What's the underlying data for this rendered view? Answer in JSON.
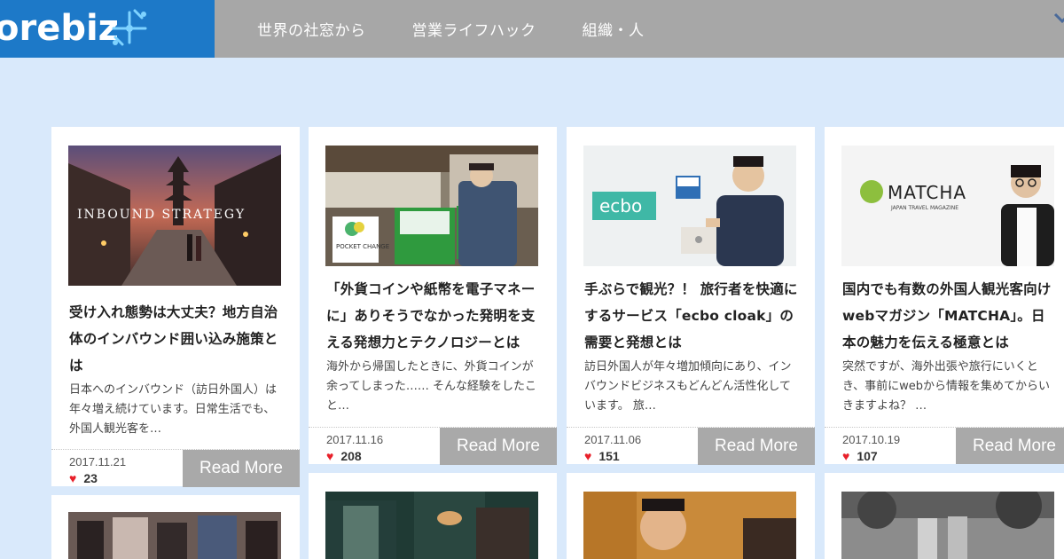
{
  "header": {
    "logo_text": "orebiz",
    "nav": [
      "世界の社窓から",
      "営業ライフハック",
      "組織・人"
    ]
  },
  "colors": {
    "brand_blue": "#1d79c8",
    "header_gray": "#a7a7a7",
    "background": "#d9e9fb",
    "heart": "#e8202a"
  },
  "cards": [
    {
      "thumb_caption": "INBOUND STRATEGY",
      "title": "受け入れ態勢は大丈夫？地方自治体のインバウンド囲い込み施策とは",
      "excerpt": "日本へのインバウンド（訪日外国人）は年々増え続けています。日常生活でも、外国人観光客を…",
      "date": "2017.11.21",
      "likes": "23",
      "read_more": "Read More"
    },
    {
      "thumb_caption": "POCKET CHANGE",
      "title": "「外貨コインや紙幣を電子マネーに」ありそうでなかった発明を支える発想力とテクノロジーとは",
      "excerpt": "海外から帰国したときに、外貨コインが余ってしまった…… そんな経験をしたこと…",
      "date": "2017.11.16",
      "likes": "208",
      "read_more": "Read More"
    },
    {
      "thumb_caption": "ecbo",
      "title": "手ぶらで観光？！ 旅行者を快適にするサービス「ecbo cloak」の需要と発想とは",
      "excerpt": "訪日外国人が年々増加傾向にあり、インバウンドビジネスもどんどん活性化しています。 旅…",
      "date": "2017.11.06",
      "likes": "151",
      "read_more": "Read More"
    },
    {
      "thumb_caption": "MATCHA",
      "thumb_subcaption": "JAPAN TRAVEL MAGAZINE",
      "title": "国内でも有数の外国人観光客向けwebマガジン「MATCHA」。日本の魅力を伝える極意とは",
      "excerpt": "突然ですが、海外出張や旅行にいくとき、事前にwebから情報を集めてからいきますよね？ …",
      "date": "2017.10.19",
      "likes": "107",
      "read_more": "Read More"
    }
  ]
}
